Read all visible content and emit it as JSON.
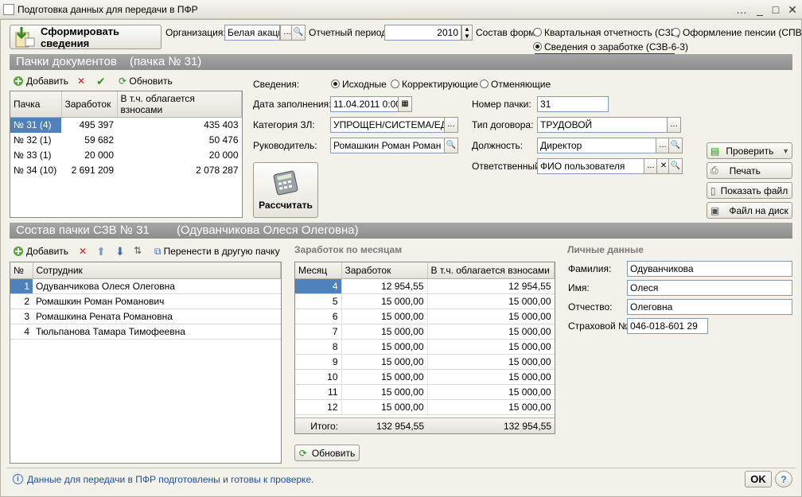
{
  "window": {
    "title": "Подготовка данных для передачи в ПФР"
  },
  "toolbar": {
    "form_button": "Сформировать сведения",
    "org_label": "Организация:",
    "org_value": "Белая акаци",
    "period_label": "Отчетный период:",
    "period_value": "2010",
    "composition_label": "Состав форм:",
    "radio_quarter": "Квартальная отчетность (СЗВ)",
    "radio_pension": "Оформление пенсии (СПВ)",
    "radio_salary": "Сведения о заработке (СЗВ-6-3)"
  },
  "packs": {
    "title": "Пачки документов",
    "subtitle": "(пачка № 31)",
    "add": "Добавить",
    "refresh": "Обновить",
    "columns": [
      "Пачка",
      "Заработок",
      "В т.ч. облагается взносами"
    ],
    "rows": [
      {
        "name": "№ 31 (4)",
        "earn": "495 397",
        "taxed": "435 403"
      },
      {
        "name": "№ 32 (1)",
        "earn": "59 682",
        "taxed": "50 476"
      },
      {
        "name": "№ 33 (1)",
        "earn": "20 000",
        "taxed": "20 000"
      },
      {
        "name": "№ 34 (10)",
        "earn": "2 691 209",
        "taxed": "2 078 287"
      }
    ]
  },
  "details": {
    "svedenia_label": "Сведения:",
    "radio_initial": "Исходные",
    "radio_correct": "Корректирующие",
    "radio_cancel": "Отменяющие",
    "date_label": "Дата заполнения:",
    "date_value": "11.04.2011 0:00",
    "category_label": "Категория ЗЛ:",
    "category_value": "УПРОЩЕН/СИСТЕМА/ЕДИ",
    "head_label": "Руководитель:",
    "head_value": "Ромашкин Роман Роман",
    "pack_no_label": "Номер пачки:",
    "pack_no_value": "31",
    "contract_label": "Тип договора:",
    "contract_value": "ТРУДОВОЙ",
    "position_label": "Должность:",
    "position_value": "Директор",
    "responsible_label": "Ответственный:",
    "responsible_value": "ФИО пользователя",
    "calc_button": "Рассчитать"
  },
  "actions": {
    "check": "Проверить",
    "print": "Печать",
    "show_file": "Показать файл",
    "file_to_disk": "Файл на диск"
  },
  "composition": {
    "title": "Состав пачки СЗВ № 31",
    "subtitle": "(Одуванчикова Олеся Олеговна)",
    "add": "Добавить",
    "move": "Перенести в другую пачку",
    "columns": [
      "№",
      "Сотрудник"
    ],
    "rows": [
      {
        "n": "1",
        "name": "Одуванчикова Олеся Олеговна"
      },
      {
        "n": "2",
        "name": "Ромашкин Роман Романович"
      },
      {
        "n": "3",
        "name": "Ромашкина Рената Романовна"
      },
      {
        "n": "4",
        "name": "Тюльпанова Тамара Тимофеевна"
      }
    ]
  },
  "monthly": {
    "title": "Заработок по месяцам",
    "columns": [
      "Месяц",
      "Заработок",
      "В т.ч. облагается взносами"
    ],
    "rows": [
      {
        "m": "4",
        "earn": "12 954,55",
        "taxed": "12 954,55"
      },
      {
        "m": "5",
        "earn": "15 000,00",
        "taxed": "15 000,00"
      },
      {
        "m": "6",
        "earn": "15 000,00",
        "taxed": "15 000,00"
      },
      {
        "m": "7",
        "earn": "15 000,00",
        "taxed": "15 000,00"
      },
      {
        "m": "8",
        "earn": "15 000,00",
        "taxed": "15 000,00"
      },
      {
        "m": "9",
        "earn": "15 000,00",
        "taxed": "15 000,00"
      },
      {
        "m": "10",
        "earn": "15 000,00",
        "taxed": "15 000,00"
      },
      {
        "m": "11",
        "earn": "15 000,00",
        "taxed": "15 000,00"
      },
      {
        "m": "12",
        "earn": "15 000,00",
        "taxed": "15 000,00"
      }
    ],
    "total_label": "Итого:",
    "total_earn": "132 954,55",
    "total_taxed": "132 954,55",
    "refresh": "Обновить"
  },
  "personal": {
    "title": "Личные данные",
    "surname_label": "Фамилия:",
    "surname_value": "Одуванчикова",
    "name_label": "Имя:",
    "name_value": "Олеся",
    "patronymic_label": "Отчество:",
    "patronymic_value": "Олеговна",
    "snils_label": "Страховой №:",
    "snils_value": "046-018-601 29"
  },
  "status": {
    "message": "Данные для передачи в ПФР подготовлены и готовы к проверке.",
    "ok": "OK",
    "help": "?"
  },
  "colors": {
    "selection": "#4f81bd",
    "accent_red": "#c00000"
  }
}
